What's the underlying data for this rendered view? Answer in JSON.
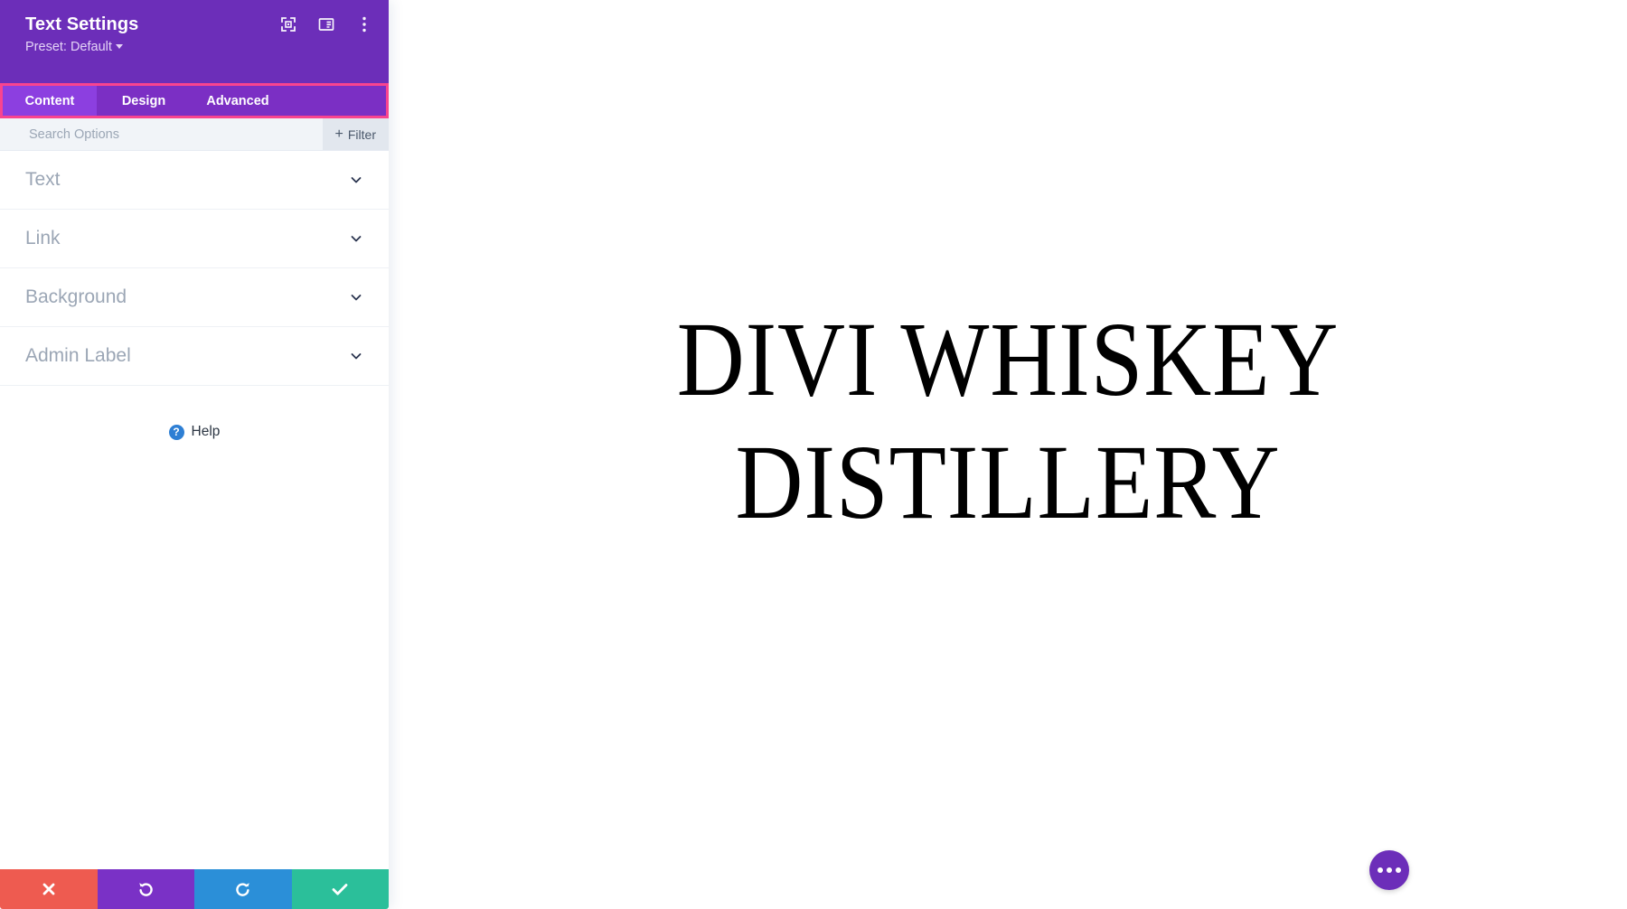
{
  "panel": {
    "title": "Text Settings",
    "preset_label": "Preset: Default",
    "header_icons": [
      {
        "name": "focus-target-icon",
        "label": "Focus"
      },
      {
        "name": "layout-panel-icon",
        "label": "Panel Layout"
      },
      {
        "name": "more-vertical-icon",
        "label": "More Options"
      }
    ],
    "tabs": [
      {
        "label": "Content",
        "active": true
      },
      {
        "label": "Design",
        "active": false
      },
      {
        "label": "Advanced",
        "active": false
      }
    ],
    "search": {
      "placeholder": "Search Options",
      "value": ""
    },
    "filter_label": "Filter",
    "sections": [
      {
        "label": "Text",
        "expanded": false
      },
      {
        "label": "Link",
        "expanded": false
      },
      {
        "label": "Background",
        "expanded": false
      },
      {
        "label": "Admin Label",
        "expanded": false
      }
    ],
    "help_label": "Help",
    "actions": [
      {
        "name": "cancel-button",
        "icon": "close-icon",
        "color": "#EE5B50"
      },
      {
        "name": "undo-button",
        "icon": "undo-icon",
        "color": "#7A31C6"
      },
      {
        "name": "redo-button",
        "icon": "redo-icon",
        "color": "#2B8FD8"
      },
      {
        "name": "save-button",
        "icon": "check-icon",
        "color": "#2BBF9A"
      }
    ]
  },
  "canvas": {
    "heading": "DIVI WHISKEY\nDISTILLERY",
    "fab_label": "More Actions"
  },
  "colors": {
    "header_purple": "#6C2EB9",
    "tab_bar_purple": "#7B2FC4",
    "tab_active_purple": "#8C3FE0",
    "highlight_pink": "#F9448F",
    "search_bg": "#F1F4F8",
    "filter_bg": "#E2E7EE",
    "section_label": "#9BA6B5",
    "help_blue": "#2E7FD4"
  }
}
